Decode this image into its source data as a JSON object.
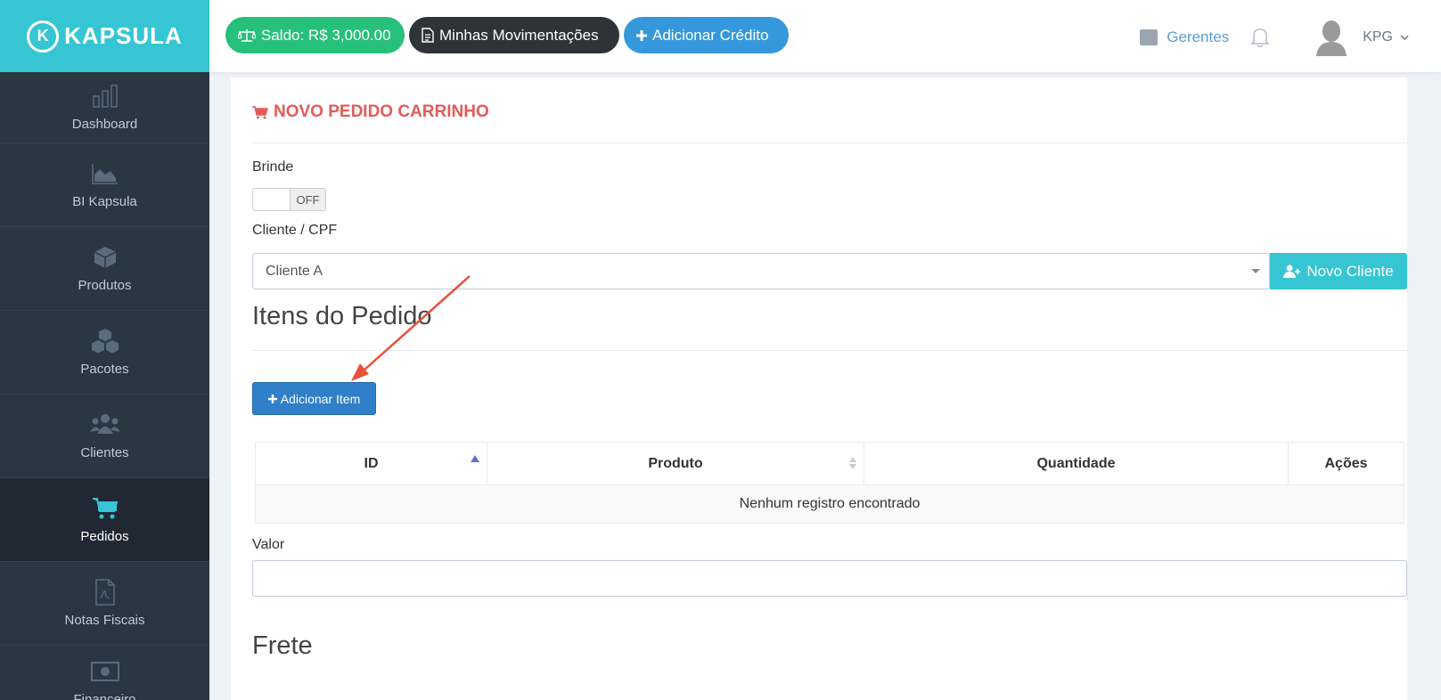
{
  "brand": {
    "name": "KAPSULA",
    "logo_letter": "K"
  },
  "sidebar": {
    "items": [
      {
        "label": "Dashboard",
        "icon": "bar-chart-icon"
      },
      {
        "label": "BI Kapsula",
        "icon": "area-chart-icon"
      },
      {
        "label": "Produtos",
        "icon": "cube-icon"
      },
      {
        "label": "Pacotes",
        "icon": "cubes-icon"
      },
      {
        "label": "Clientes",
        "icon": "users-icon"
      },
      {
        "label": "Pedidos",
        "icon": "cart-icon",
        "active": true
      },
      {
        "label": "Notas Fiscais",
        "icon": "file-pdf-icon"
      },
      {
        "label": "Financeiro",
        "icon": "money-icon"
      }
    ]
  },
  "topbar": {
    "saldo": "Saldo: R$ 3,000.00",
    "movimentacoes": "Minhas Movimentações",
    "adicionar_credito": "Adicionar Crédito",
    "gerentes": "Gerentes",
    "user": "KPG"
  },
  "main": {
    "title": "NOVO PEDIDO CARRINHO",
    "brinde_label": "Brinde",
    "toggle_state": "OFF",
    "cliente_label": "Cliente / CPF",
    "cliente_value": "Cliente A",
    "novo_cliente": "Novo Cliente",
    "itens_title": "Itens do Pedido",
    "add_item": "Adicionar Item",
    "table": {
      "columns": [
        "ID",
        "Produto",
        "Quantidade",
        "Ações"
      ],
      "empty": "Nenhum registro encontrado"
    },
    "valor_label": "Valor",
    "frete_title": "Frete"
  },
  "colors": {
    "sidebar": "#2b3643",
    "brand": "#36c6d3",
    "accent_red": "#e35b5a",
    "annotation_arrow": "#e8503a"
  }
}
